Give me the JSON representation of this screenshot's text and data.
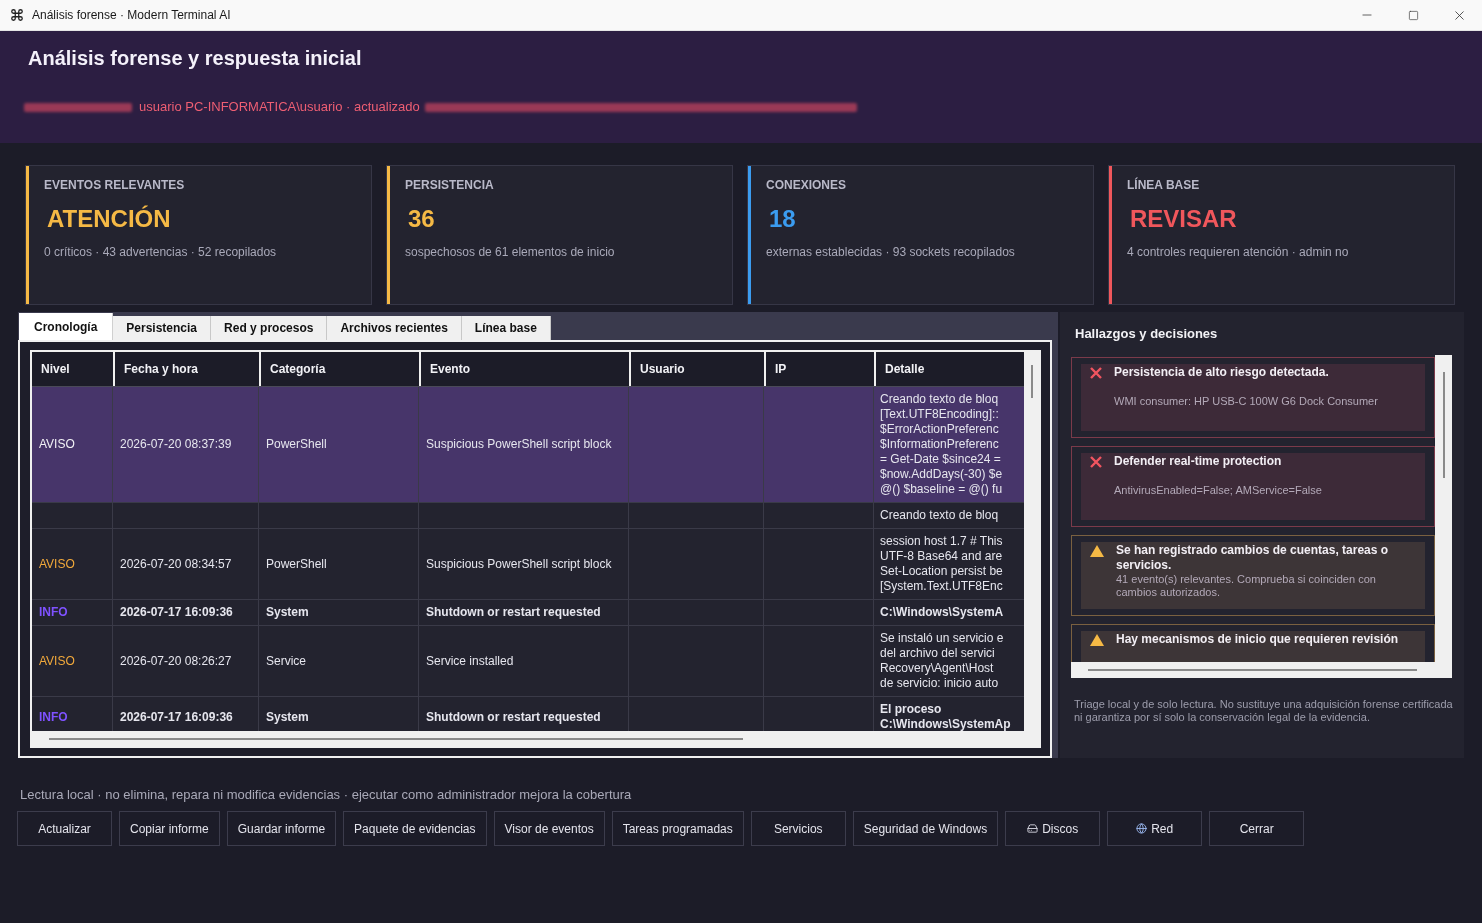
{
  "window": {
    "title": "Análisis forense · Modern Terminal AI"
  },
  "header": {
    "title": "Análisis forense y respuesta inicial",
    "subtitle": "usuario PC-INFORMATICA\\usuario · actualizado"
  },
  "cards": [
    {
      "label": "EVENTOS RELEVANTES",
      "value": "ATENCIÓN",
      "detail": "0 críticos · 43 advertencias · 52 recopilados",
      "color": "#f5b945"
    },
    {
      "label": "PERSISTENCIA",
      "value": "36",
      "detail": "sospechosos de 61 elementos de inicio",
      "color": "#f5b945"
    },
    {
      "label": "CONEXIONES",
      "value": "18",
      "detail": "externas establecidas · 93 sockets recopilados",
      "color": "#3b9cf0"
    },
    {
      "label": "LÍNEA BASE",
      "value": "REVISAR",
      "detail": "4 controles requieren atención · admin no",
      "color": "#f0575c"
    }
  ],
  "tabs": [
    {
      "label": "Cronología",
      "selected": true
    },
    {
      "label": "Persistencia",
      "selected": false
    },
    {
      "label": "Red y procesos",
      "selected": false
    },
    {
      "label": "Archivos recientes",
      "selected": false
    },
    {
      "label": "Línea base",
      "selected": false
    }
  ],
  "table": {
    "columns": [
      "Nivel",
      "Fecha y hora",
      "Categoría",
      "Evento",
      "Usuario",
      "IP",
      "Detalle"
    ],
    "rows": [
      {
        "kind": "warning",
        "selected": true,
        "level": "AVISO",
        "date": "2026-07-20 08:37:39",
        "category": "PowerShell",
        "event": "Suspicious PowerShell script block",
        "detail": [
          "Creando texto de bloq",
          "[Text.UTF8Encoding]::",
          "$ErrorActionPreferenc",
          "$InformationPreferenc",
          "= Get-Date $since24 =",
          "$now.AddDays(-30) $e",
          "@() $baseline = @() fu"
        ]
      },
      {
        "kind": "blank",
        "selected": false,
        "detail": [
          "Creando texto de bloq"
        ]
      },
      {
        "kind": "warning",
        "selected": false,
        "level": "AVISO",
        "date": "2026-07-20 08:34:57",
        "category": "PowerShell",
        "event": "Suspicious PowerShell script block",
        "detail": [
          "session host 1.7 # This",
          "UTF-8 Base64 and are",
          "Set-Location persist be",
          "[System.Text.UTF8Enc"
        ]
      },
      {
        "kind": "info",
        "selected": false,
        "level": "INFO",
        "date": "2026-07-17 16:09:36",
        "category": "System",
        "event": "Shutdown or restart requested",
        "detail": [
          "C:\\Windows\\SystemA"
        ]
      },
      {
        "kind": "warning",
        "selected": false,
        "level": "AVISO",
        "date": "2026-07-20 08:26:27",
        "category": "Service",
        "event": "Service installed",
        "detail": [
          "Se instaló un servicio e",
          "del archivo del servici",
          "Recovery\\Agent\\Host",
          "de servicio: inicio auto"
        ]
      },
      {
        "kind": "info",
        "selected": false,
        "level": "INFO",
        "date": "2026-07-17 16:09:36",
        "category": "System",
        "event": "Shutdown or restart requested",
        "detail": [
          "El proceso",
          "C:\\Windows\\SystemAp"
        ]
      }
    ]
  },
  "findings": {
    "title": "Hallazgos y decisiones",
    "items": [
      {
        "kind": "error",
        "title": "Persistencia de alto riesgo detectada.",
        "detail": "WMI consumer: HP USB-C 100W G6 Dock Consumer"
      },
      {
        "kind": "error",
        "title": "Defender real-time protection",
        "detail": "AntivirusEnabled=False; AMService=False"
      },
      {
        "kind": "warning",
        "title": "Se han registrado cambios de cuentas, tareas o servicios.",
        "detail": "41 evento(s) relevantes. Comprueba si coinciden con cambios autorizados."
      },
      {
        "kind": "warning",
        "title": "Hay mecanismos de inicio que requieren revisión"
      }
    ],
    "note": "Triage local y de solo lectura. No sustituye una adquisición forense certificada ni garantiza por sí solo la conservación legal de la evidencia."
  },
  "status": "Lectura local · no elimina, repara ni modifica evidencias · ejecutar como administrador mejora la cobertura",
  "buttons": [
    {
      "label": "Actualizar",
      "kind": "plain"
    },
    {
      "label": "Copiar informe",
      "kind": "plain"
    },
    {
      "label": "Guardar informe",
      "kind": "plain"
    },
    {
      "label": "Paquete de evidencias",
      "kind": "plain"
    },
    {
      "label": "Visor de eventos",
      "kind": "plain"
    },
    {
      "label": "Tareas programadas",
      "kind": "plain"
    },
    {
      "label": "Servicios",
      "kind": "plain"
    },
    {
      "label": "Seguridad de Windows",
      "kind": "plain"
    },
    {
      "label": "Discos",
      "kind": "disk"
    },
    {
      "label": "Red",
      "kind": "network"
    },
    {
      "label": "Cerrar",
      "kind": "plain"
    }
  ]
}
